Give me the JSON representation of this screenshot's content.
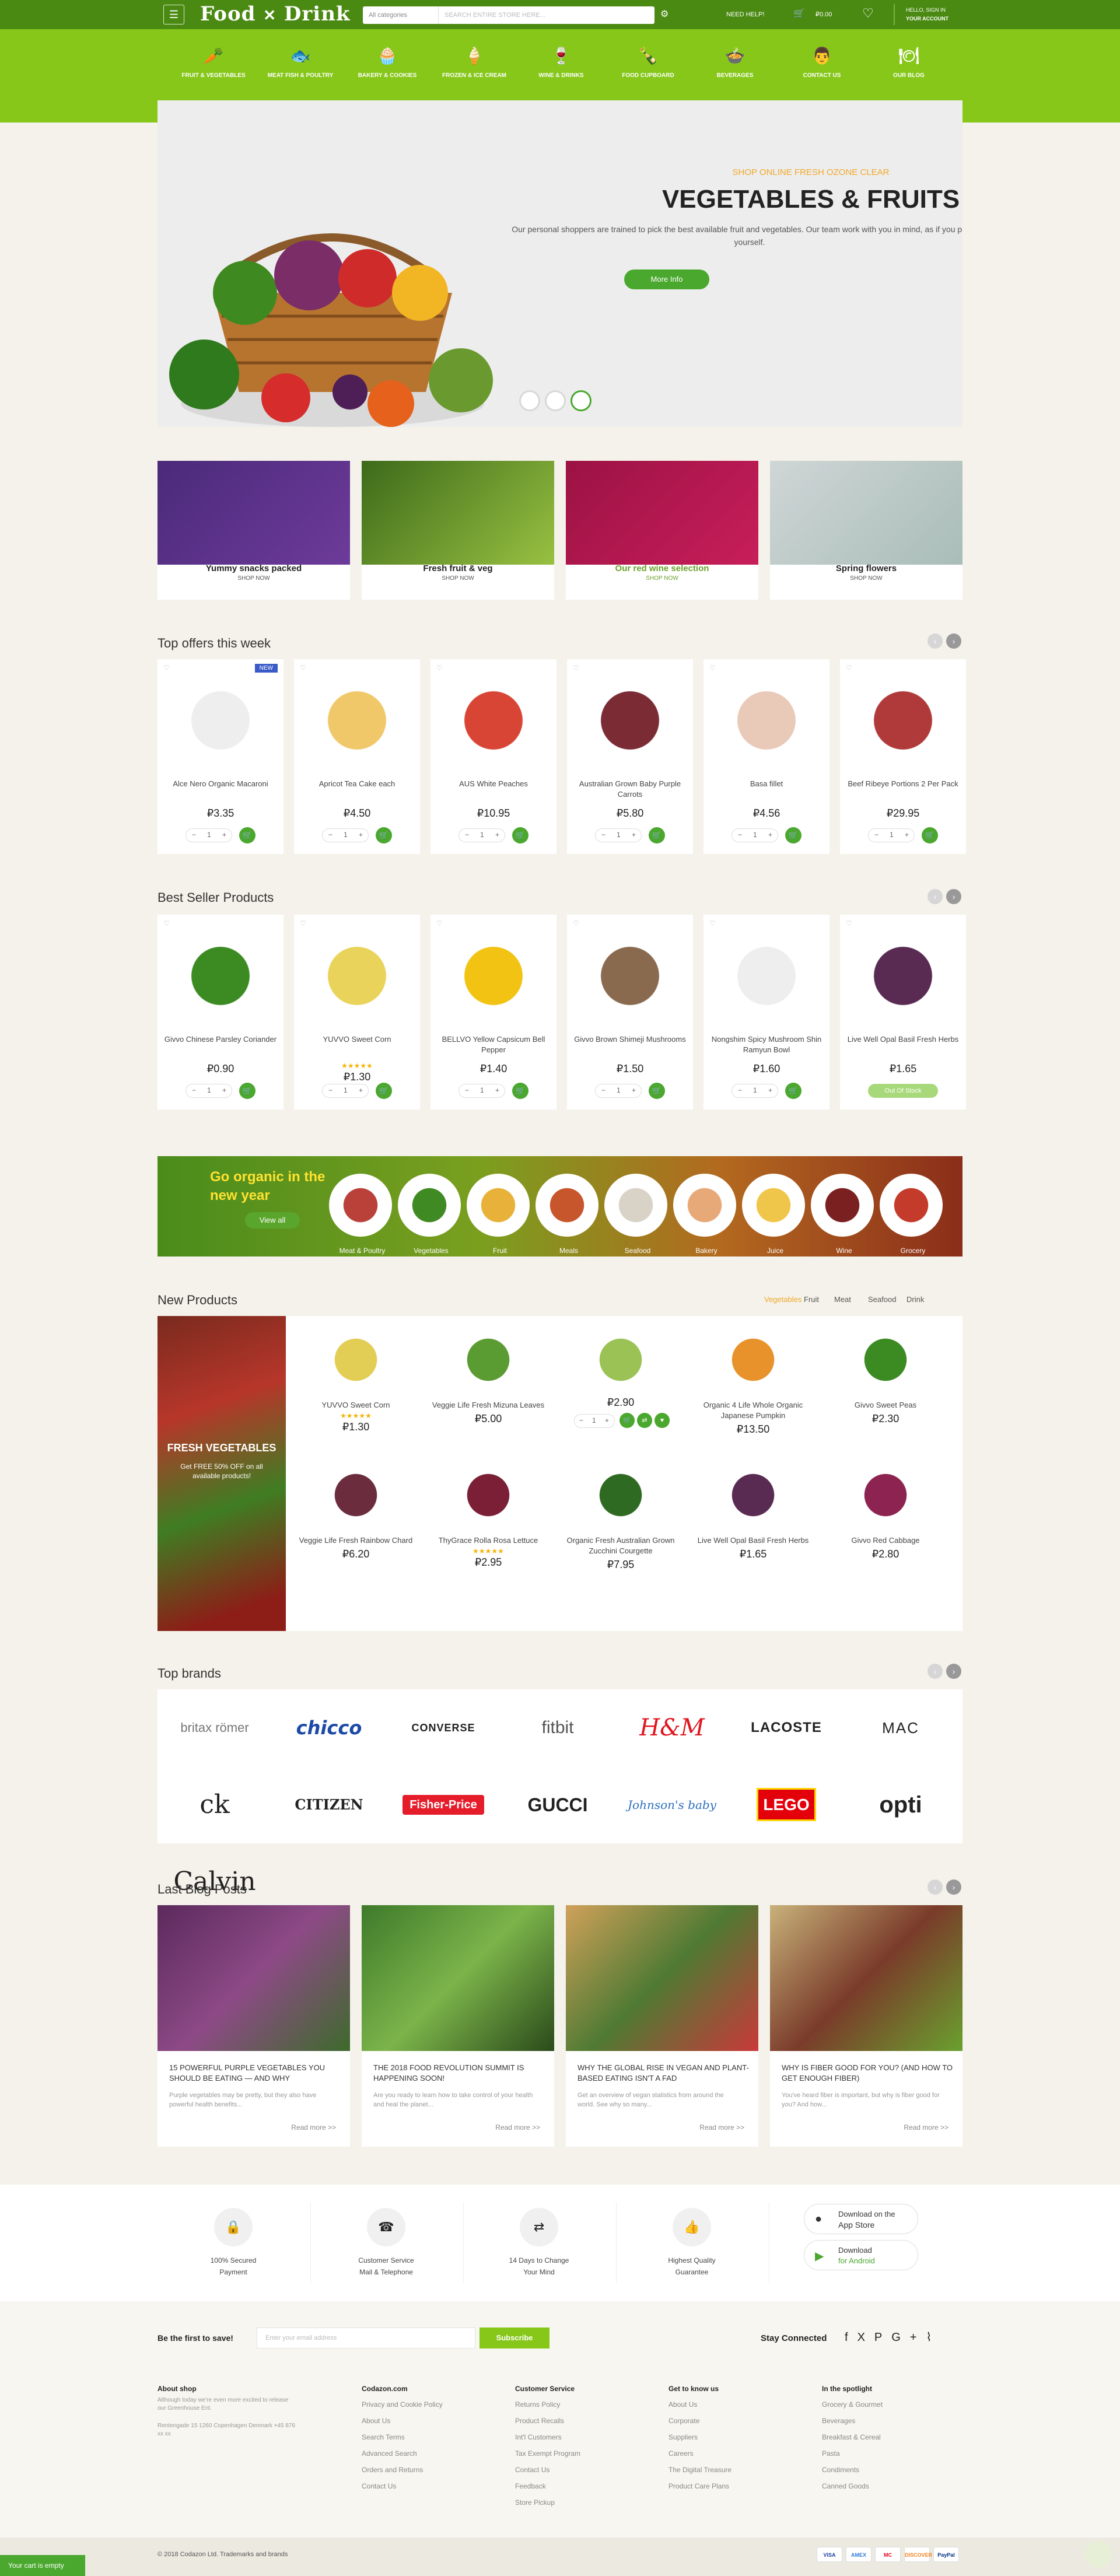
{
  "colors": {
    "header_dark": "#4a8a12",
    "header_light": "#86c71a",
    "accent_green": "#4aa82f",
    "orange": "#f0a92a"
  },
  "header": {
    "logo_left": "Food",
    "logo_sep": "✕",
    "logo_right": "Drink",
    "search_category": "All categories",
    "search_placeholder": "SEARCH ENTIRE STORE HERE...",
    "need_help": "NEED HELP!",
    "cart_total": "₽0.00",
    "account_line1": "HELLO, SIGN IN",
    "account_line2": "YOUR ACCOUNT"
  },
  "nav": [
    {
      "label": "FRUIT & VEGETABLES",
      "icon": "carrot-icon"
    },
    {
      "label": "MEAT FISH & POULTRY",
      "icon": "fish-icon"
    },
    {
      "label": "BAKERY & COOKIES",
      "icon": "cupcake-icon"
    },
    {
      "label": "FROZEN & ICE CREAM",
      "icon": "ice-cream-icon"
    },
    {
      "label": "WINE & DRINKS",
      "icon": "wine-bottle-icon"
    },
    {
      "label": "FOOD CUPBOARD",
      "icon": "bottle-icon"
    },
    {
      "label": "BEVERAGES",
      "icon": "pot-icon"
    },
    {
      "label": "CONTACT US",
      "icon": "chef-hat-icon"
    },
    {
      "label": "OUR BLOG",
      "icon": "meal-icon"
    }
  ],
  "hero": {
    "pre": "SHOP ONLINE FRESH OZONE CLEAR",
    "title": "VEGETABLES & FRUITS",
    "desc": "Our personal shoppers are trained to pick the best available fruit and vegetables. Our team work with you in mind, as if you picked it yourself.",
    "button": "More Info"
  },
  "categories": [
    {
      "title": "Yummy snacks packed",
      "sub": "SHOP NOW"
    },
    {
      "title": "Fresh fruit & veg",
      "sub": "SHOP NOW"
    },
    {
      "title": "Our red wine selection",
      "sub": "SHOP NOW"
    },
    {
      "title": "Spring flowers",
      "sub": "SHOP NOW"
    }
  ],
  "top_offers": {
    "title": "Top offers this week",
    "items": [
      {
        "name": "Alce Nero Organic Macaroni",
        "price": "₽3.35",
        "badge": "NEW"
      },
      {
        "name": "Apricot Tea Cake each",
        "price": "₽4.50"
      },
      {
        "name": "AUS White Peaches",
        "price": "₽10.95"
      },
      {
        "name": "Australian Grown Baby Purple Carrots",
        "price": "₽5.80"
      },
      {
        "name": "Basa fillet",
        "price": "₽4.56"
      },
      {
        "name": "Beef Ribeye Portions 2 Per Pack",
        "price": "₽29.95"
      }
    ]
  },
  "best_sellers": {
    "title": "Best Seller Products",
    "items": [
      {
        "name": "Givvo Chinese Parsley Coriander",
        "price": "₽0.90"
      },
      {
        "name": "YUVVO Sweet Corn",
        "price": "₽1.30",
        "rating": "★★★★★"
      },
      {
        "name": "BELLVO Yellow Capsicum Bell Pepper",
        "price": "₽1.40"
      },
      {
        "name": "Givvo Brown Shimeji Mushrooms",
        "price": "₽1.50"
      },
      {
        "name": "Nongshim Spicy Mushroom Shin Ramyun Bowl",
        "price": "₽1.60"
      },
      {
        "name": "Live Well Opal Basil Fresh Herbs",
        "price": "₽1.65",
        "status": "Out Of Stock"
      }
    ]
  },
  "qty_default": "1",
  "qty_minus": "−",
  "qty_plus": "+",
  "organic": {
    "headline": "Go organic in the new year",
    "button": "View all",
    "items": [
      "Meat & Poultry",
      "Vegetables",
      "Fruit",
      "Meals",
      "Seafood",
      "Bakery",
      "Juice",
      "Wine",
      "Grocery"
    ]
  },
  "new_products": {
    "title": "New Products",
    "tabs": [
      "Vegetables",
      "Fruit",
      "Meat",
      "Seafood",
      "Drink"
    ],
    "promo_title": "FRESH VEGETABLES",
    "promo_text": "Get FREE 50% OFF on all available products!",
    "items": [
      {
        "name": "YUVVO Sweet Corn",
        "price": "₽1.30",
        "rating": "★★★★★"
      },
      {
        "name": "Veggie Life Fresh Mizuna Leaves",
        "price": "₽5.00"
      },
      {
        "name": "",
        "price": "₽2.90"
      },
      {
        "name": "Organic 4 Life Whole Organic Japanese Pumpkin",
        "price": "₽13.50"
      },
      {
        "name": "Givvo Sweet Peas",
        "price": "₽2.30"
      },
      {
        "name": "Veggie Life Fresh Rainbow Chard",
        "price": "₽6.20"
      },
      {
        "name": "ThyGrace Rolla Rosa Lettuce",
        "price": "₽2.95",
        "rating": "★★★★★"
      },
      {
        "name": "Organic Fresh Australian Grown Zucchini Courgette",
        "price": "₽7.95"
      },
      {
        "name": "Live Well Opal Basil Fresh Herbs",
        "price": "₽1.65"
      },
      {
        "name": "Givvo Red Cabbage",
        "price": "₽2.80"
      }
    ]
  },
  "brands": {
    "title": "Top brands",
    "items": [
      "britax römer",
      "chicco",
      "CONVERSE",
      "fitbit",
      "H&M",
      "LACOSTE",
      "MAC",
      "ck Calvin Klein",
      "CITIZEN",
      "Fisher-Price",
      "GUCCI",
      "Johnson's baby",
      "LEGO",
      "opti"
    ]
  },
  "blog": {
    "title": "Last Blog Posts",
    "read_more": "Read more >>",
    "posts": [
      {
        "title": "15 POWERFUL PURPLE VEGETABLES YOU SHOULD BE EATING — AND WHY",
        "desc": "Purple vegetables may be pretty, but they also have powerful health benefits..."
      },
      {
        "title": "THE 2018 FOOD REVOLUTION SUMMIT IS HAPPENING SOON!",
        "desc": "Are you ready to learn how to take control of your health and heal the planet..."
      },
      {
        "title": "WHY THE GLOBAL RISE IN VEGAN AND PLANT-BASED EATING ISN'T A FAD",
        "desc": "Get an overview of vegan statistics from around the world. See why so many..."
      },
      {
        "title": "WHY IS FIBER GOOD FOR YOU? (AND HOW TO GET ENOUGH FIBER)",
        "desc": "You've heard fiber is important, but why is fiber good for you? And how..."
      }
    ]
  },
  "services": [
    {
      "l1": "100% Secured",
      "l2": "Payment",
      "icon": "lock-icon"
    },
    {
      "l1": "Customer Service",
      "l2": "Mail & Telephone",
      "icon": "phone-icon"
    },
    {
      "l1": "14 Days to Change",
      "l2": "Your Mind",
      "icon": "exchange-icon"
    },
    {
      "l1": "Highest Quality",
      "l2": "Guarantee",
      "icon": "thumbs-up-icon"
    }
  ],
  "apps": [
    {
      "l1": "Download on the",
      "l2": "App Store"
    },
    {
      "l1": "Download",
      "l2": "for Android"
    }
  ],
  "newsletter": {
    "label": "Be the first to save!",
    "placeholder": "Enter your email address",
    "button": "Subscribe",
    "stay": "Stay Connected"
  },
  "footer": {
    "about": {
      "title": "About shop",
      "text": "Although today we're even more excited to release our Greenhouse Ent.",
      "address": "Rentengade 15 1260 Copenhagen Denmark +45 876 xx xx"
    },
    "cols": [
      {
        "title": "Codazon.com",
        "links": [
          "Privacy and Cookie Policy",
          "About Us",
          "Search Terms",
          "Advanced Search",
          "Orders and Returns",
          "Contact Us"
        ]
      },
      {
        "title": "Customer Service",
        "links": [
          "Returns Policy",
          "Product Recalls",
          "Int'l Customers",
          "Tax Exempt Program",
          "Contact Us",
          "Feedback",
          "Store Pickup"
        ]
      },
      {
        "title": "Get to know us",
        "links": [
          "About Us",
          "Corporate",
          "Suppliers",
          "Careers",
          "The Digital Treasure",
          "Product Care Plans"
        ]
      },
      {
        "title": "In the spotlight",
        "links": [
          "Grocery & Gourmet",
          "Beverages",
          "Breakfast & Cereal",
          "Pasta",
          "Condiments",
          "Canned Goods"
        ]
      }
    ],
    "copyright": "© 2018 Codazon Ltd. Trademarks and brands",
    "cart_status": "Your cart is empty",
    "payments": [
      "VISA",
      "AMEX",
      "MC",
      "DISCOVER",
      "PayPal"
    ]
  }
}
